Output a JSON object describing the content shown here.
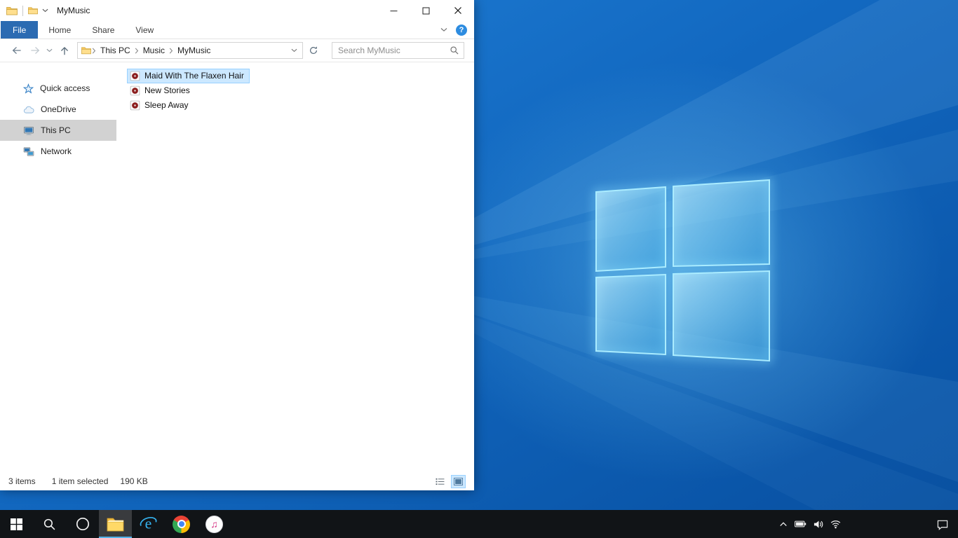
{
  "colors": {
    "accent_file_tab": "#2b6bb2",
    "selection_bg": "#cce8ff",
    "selection_border": "#99d1ff",
    "sidebar_selected_bg": "#d2d2d2",
    "taskbar_bg": "#111417",
    "wallpaper_blue": "#1268c0",
    "logo_cyan": "#8fe8ff"
  },
  "window": {
    "title": "MyMusic",
    "ribbon": {
      "file_tab": "File",
      "tabs": [
        "Home",
        "Share",
        "View"
      ],
      "help": "?"
    },
    "navbar": {
      "breadcrumb": [
        "This PC",
        "Music",
        "MyMusic"
      ],
      "search_placeholder": "Search MyMusic"
    },
    "sidebar": {
      "items": [
        {
          "label": "Quick access",
          "icon": "star-icon",
          "selected": false
        },
        {
          "label": "OneDrive",
          "icon": "cloud-icon",
          "selected": false
        },
        {
          "label": "This PC",
          "icon": "computer-icon",
          "selected": true
        },
        {
          "label": "Network",
          "icon": "network-icon",
          "selected": false
        }
      ]
    },
    "files": [
      {
        "name": "Maid With The Flaxen Hair",
        "icon": "audio-file-icon",
        "selected": true
      },
      {
        "name": "New Stories",
        "icon": "audio-file-icon",
        "selected": false
      },
      {
        "name": "Sleep Away",
        "icon": "audio-file-icon",
        "selected": false
      }
    ],
    "statusbar": {
      "items_count": "3 items",
      "selection": "1 item selected",
      "size": "190 KB"
    }
  },
  "taskbar": {
    "buttons": [
      {
        "name": "start",
        "icon": "windows-logo-icon"
      },
      {
        "name": "search",
        "icon": "search-icon"
      },
      {
        "name": "cortana",
        "icon": "cortana-circle-icon"
      },
      {
        "name": "file-explorer",
        "icon": "folder-icon",
        "active": true
      },
      {
        "name": "internet-explorer",
        "icon": "ie-icon"
      },
      {
        "name": "chrome",
        "icon": "chrome-icon"
      },
      {
        "name": "itunes",
        "icon": "music-note-icon"
      }
    ],
    "tray_icons": [
      "chevron-up-icon",
      "battery-icon",
      "volume-icon",
      "wifi-icon"
    ],
    "action_center": "action-center-icon"
  }
}
